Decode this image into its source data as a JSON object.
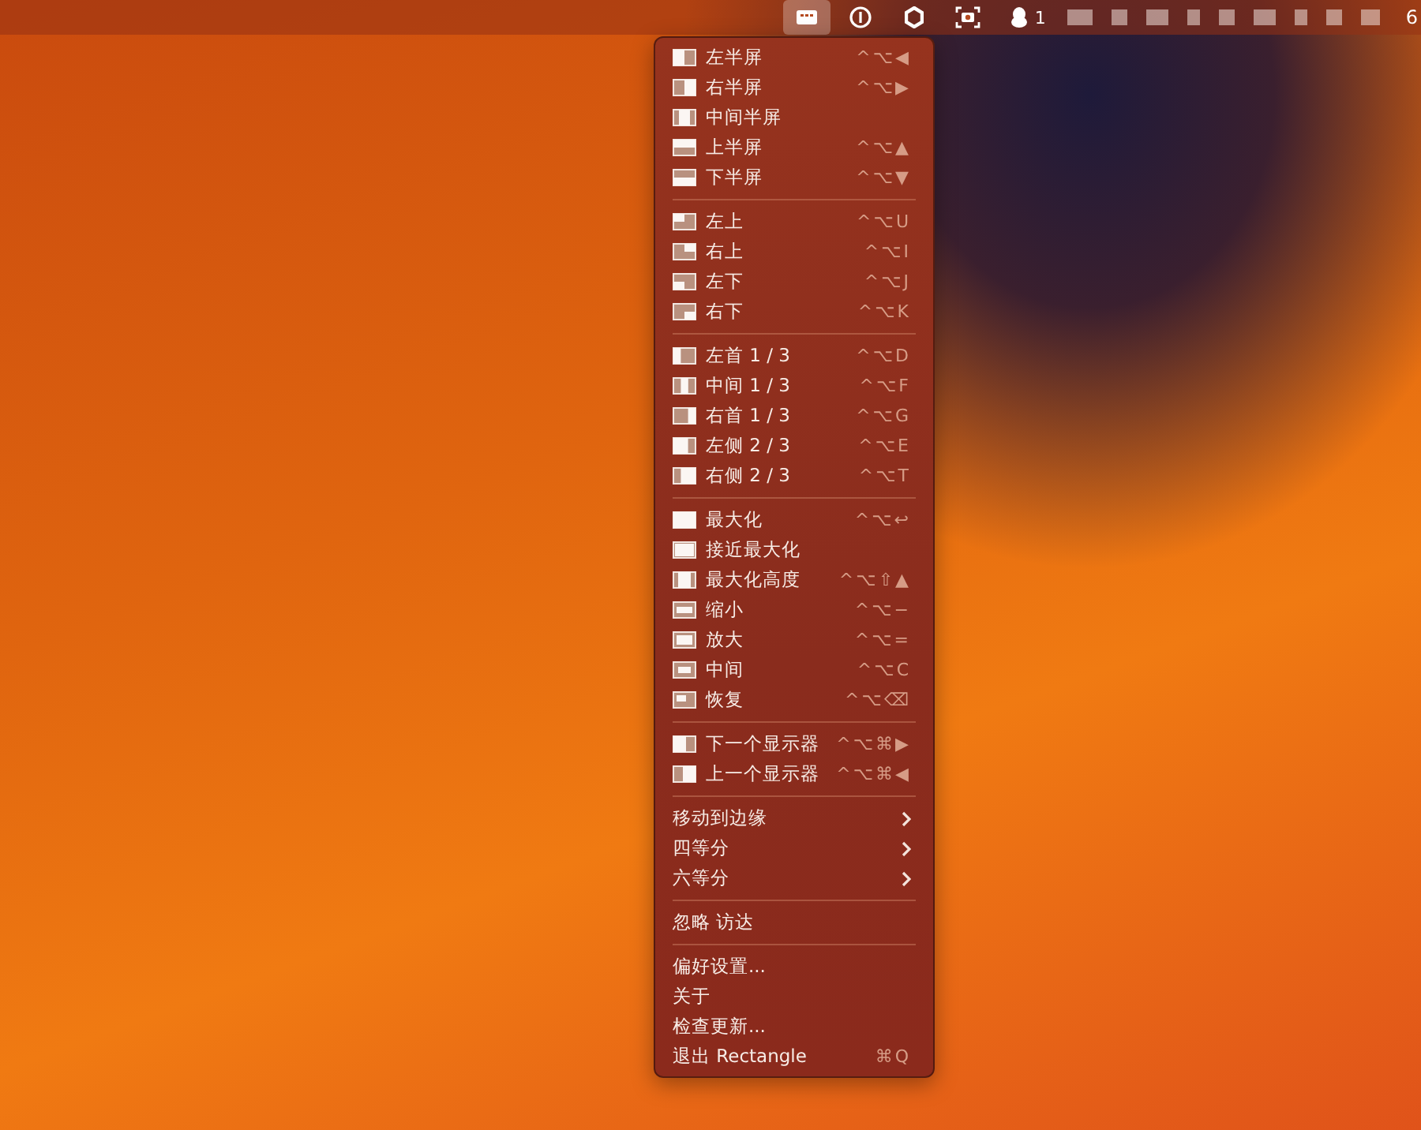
{
  "menu_bar": {
    "status_icons": [
      {
        "selected": true
      },
      {
        "selected": false
      },
      {
        "selected": false
      },
      {
        "selected": false
      }
    ],
    "notification_count": "1",
    "clock": "6"
  },
  "menu": {
    "groups": [
      {
        "items": [
          {
            "kind": "action",
            "label": "左半屏",
            "shortcut": "^⌥◀"
          },
          {
            "kind": "action",
            "label": "右半屏",
            "shortcut": "^⌥▶"
          },
          {
            "kind": "action",
            "label": "中间半屏"
          },
          {
            "kind": "action",
            "label": "上半屏",
            "shortcut": "^⌥▲"
          },
          {
            "kind": "action",
            "label": "下半屏",
            "shortcut": "^⌥▼"
          }
        ]
      },
      {
        "items": [
          {
            "kind": "action",
            "label": "左上",
            "shortcut": "^⌥U"
          },
          {
            "kind": "action",
            "label": "右上",
            "shortcut": "^⌥I"
          },
          {
            "kind": "action",
            "label": "左下",
            "shortcut": "^⌥J"
          },
          {
            "kind": "action",
            "label": "右下",
            "shortcut": "^⌥K"
          }
        ]
      },
      {
        "items": [
          {
            "kind": "action",
            "label": "左首 1 / 3",
            "shortcut": "^⌥D"
          },
          {
            "kind": "action",
            "label": "中间 1 / 3",
            "shortcut": "^⌥F"
          },
          {
            "kind": "action",
            "label": "右首 1 / 3",
            "shortcut": "^⌥G"
          },
          {
            "kind": "action",
            "label": "左侧 2 / 3",
            "shortcut": "^⌥E"
          },
          {
            "kind": "action",
            "label": "右侧 2 / 3",
            "shortcut": "^⌥T"
          }
        ]
      },
      {
        "items": [
          {
            "kind": "action",
            "label": "最大化",
            "shortcut": "^⌥↩"
          },
          {
            "kind": "action",
            "label": "接近最大化"
          },
          {
            "kind": "action",
            "label": "最大化高度",
            "shortcut": "^⌥⇧▲"
          },
          {
            "kind": "action",
            "label": "缩小",
            "shortcut": "^⌥−"
          },
          {
            "kind": "action",
            "label": "放大",
            "shortcut": "^⌥="
          },
          {
            "kind": "action",
            "label": "中间",
            "shortcut": "^⌥C"
          },
          {
            "kind": "action",
            "label": "恢复",
            "shortcut": "^⌥⌫"
          }
        ]
      },
      {
        "items": [
          {
            "kind": "action",
            "label": "下一个显示器",
            "shortcut": "^⌥⌘▶"
          },
          {
            "kind": "action",
            "label": "上一个显示器",
            "shortcut": "^⌥⌘◀"
          }
        ]
      },
      {
        "items": [
          {
            "kind": "submenu",
            "label": "移动到边缘"
          },
          {
            "kind": "submenu",
            "label": "四等分"
          },
          {
            "kind": "submenu",
            "label": "六等分"
          }
        ]
      },
      {
        "items": [
          {
            "kind": "plain",
            "label": "忽略 访达"
          }
        ]
      },
      {
        "items": [
          {
            "kind": "plain",
            "label": "偏好设置..."
          },
          {
            "kind": "plain",
            "label": "关于"
          },
          {
            "kind": "plain",
            "label": "检查更新..."
          },
          {
            "kind": "plain",
            "label": "退出 Rectangle",
            "shortcut": "⌘Q"
          }
        ]
      }
    ]
  }
}
